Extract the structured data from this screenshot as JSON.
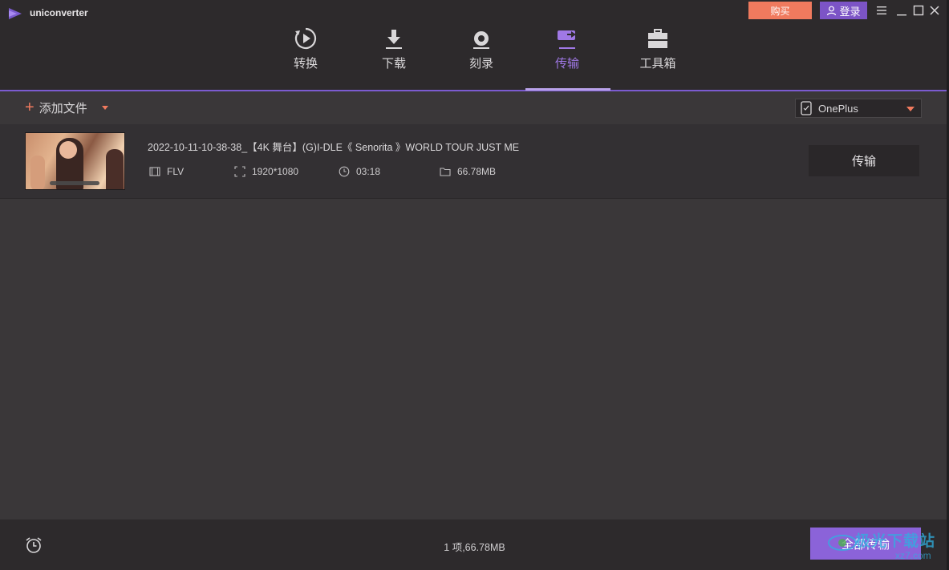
{
  "app": {
    "name": "uniconverter",
    "buy_label": "购买",
    "login_label": "登录"
  },
  "nav": {
    "items": [
      {
        "label": "转换",
        "icon": "convert-icon"
      },
      {
        "label": "下载",
        "icon": "download-icon"
      },
      {
        "label": "刻录",
        "icon": "burn-disc-icon"
      },
      {
        "label": "传输",
        "icon": "transfer-icon",
        "active": true
      },
      {
        "label": "工具箱",
        "icon": "toolbox-icon"
      }
    ]
  },
  "toolbar": {
    "add_file_label": "添加文件",
    "device": "OnePlus"
  },
  "files": [
    {
      "title": "2022-10-11-10-38-38_【4K 舞台】(G)I-DLE《 Senorita 》WORLD TOUR JUST ME",
      "format": "FLV",
      "resolution": "1920*1080",
      "duration": "03:18",
      "size": "66.78MB",
      "action_label": "传输"
    }
  ],
  "footer": {
    "summary": "1 项,66.78MB",
    "transfer_all_label": "全部传输"
  },
  "watermark": {
    "text": "极光下载站",
    "sub": "xz7.com"
  },
  "colors": {
    "accent": "#8b63d9",
    "buy": "#f07a5e",
    "login": "#7c54c6",
    "active_tab": "#a078e6"
  }
}
